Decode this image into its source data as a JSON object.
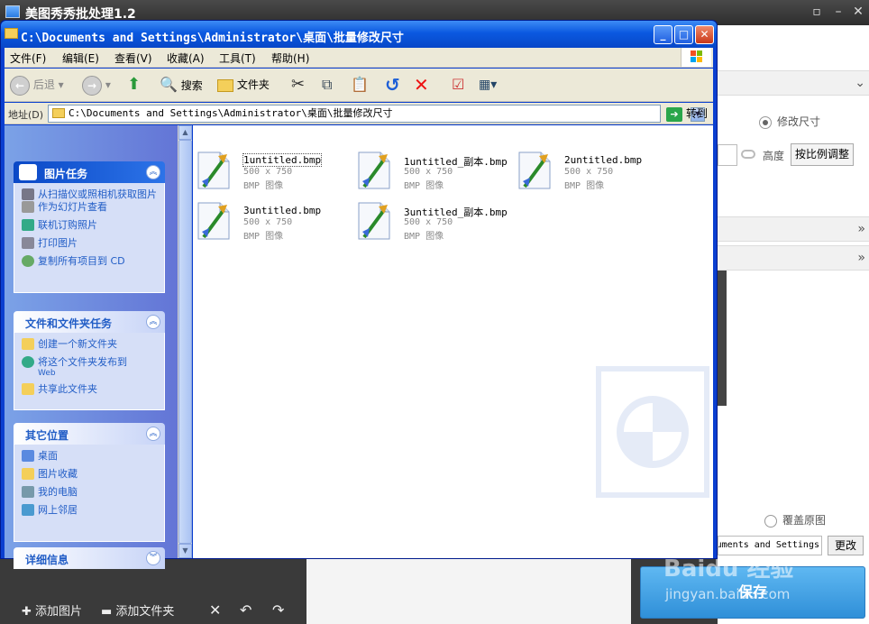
{
  "app": {
    "title": "美图秀秀批处理1.2",
    "bottom_bar": {
      "add_images": "添加图片",
      "add_folder": "添加文件夹"
    },
    "right_panel": {
      "resize_radio": "修改尺寸",
      "height_label": "高度",
      "ratio_button": "按比例调整",
      "overwrite_radio": "覆盖原图",
      "save_path": "C:\\Documents and Settings\\",
      "change_button": "更改",
      "save_button": "保存"
    },
    "watermark": {
      "line1": "Baidu 经验",
      "line2": "jingyan.baidu.com"
    }
  },
  "explorer": {
    "title": "C:\\Documents and Settings\\Administrator\\桌面\\批量修改尺寸",
    "menu": [
      "文件(F)",
      "编辑(E)",
      "查看(V)",
      "收藏(A)",
      "工具(T)",
      "帮助(H)"
    ],
    "toolbar": {
      "back": "后退",
      "search": "搜索",
      "folders": "文件夹"
    },
    "address": {
      "label": "地址(D)",
      "value": "C:\\Documents and Settings\\Administrator\\桌面\\批量修改尺寸",
      "go": "转到"
    },
    "tasks": {
      "picture_tasks": {
        "title": "图片任务",
        "items": [
          "从扫描仪或照相机获取图片",
          "作为幻灯片查看",
          "联机订购照片",
          "打印图片",
          "复制所有项目到 CD"
        ]
      },
      "file_tasks": {
        "title": "文件和文件夹任务",
        "items": [
          "创建一个新文件夹",
          "将这个文件夹发布到",
          "共享此文件夹"
        ],
        "web_sub": "Web"
      },
      "other_places": {
        "title": "其它位置",
        "items": [
          "桌面",
          "图片收藏",
          "我的电脑",
          "网上邻居"
        ]
      },
      "details": {
        "title": "详细信息"
      }
    },
    "files": [
      {
        "name": "1untitled.bmp",
        "size": "500 x 750",
        "type": "BMP 图像"
      },
      {
        "name": "1untitled_副本.bmp",
        "size": "500 x 750",
        "type": "BMP 图像"
      },
      {
        "name": "2untitled.bmp",
        "size": "500 x 750",
        "type": "BMP 图像"
      },
      {
        "name": "3untitled.bmp",
        "size": "500 x 750",
        "type": "BMP 图像"
      },
      {
        "name": "3untitled_副本.bmp",
        "size": "500 x 750",
        "type": "BMP 图像"
      }
    ]
  }
}
